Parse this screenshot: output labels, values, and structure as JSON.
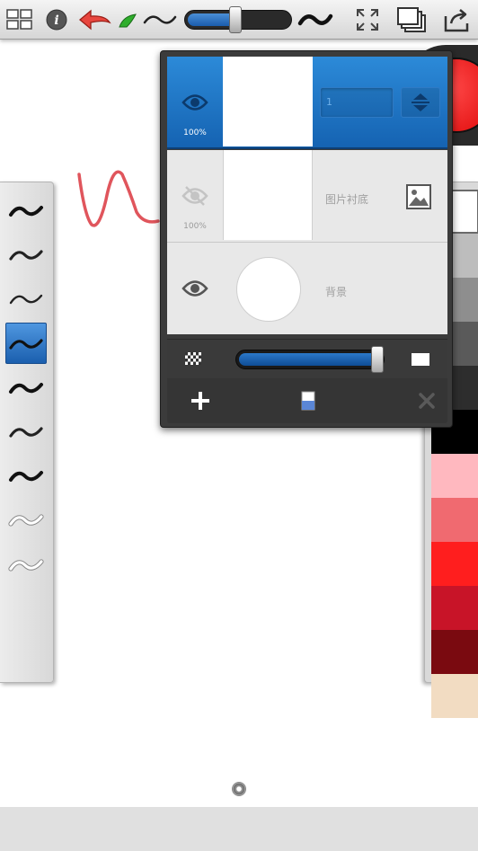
{
  "colors": {
    "accent": "#1a6ec2",
    "current_color": "#e81010"
  },
  "toolbar": {
    "items": [
      {
        "name": "grid-menu-icon"
      },
      {
        "name": "info-icon"
      },
      {
        "name": "undo-icon"
      },
      {
        "name": "brush-tool-icon"
      },
      {
        "name": "brush-size-small-icon"
      },
      {
        "name": "brush-size-large-icon"
      },
      {
        "name": "fullscreen-icon"
      },
      {
        "name": "layers-icon"
      },
      {
        "name": "share-icon"
      }
    ],
    "brush_size_level": 0.5
  },
  "brushes": {
    "items": [
      "tilde-bold",
      "tilde-medium",
      "tilde-thin",
      "tilde-selected",
      "tilde-bold",
      "tilde-medium",
      "tilde-bold",
      "tilde-white-outline",
      "tilde-white-outline"
    ],
    "selected_index": 3
  },
  "palette": {
    "swatches": [
      "#ffffff",
      "#bdbdbd",
      "#8e8e8e",
      "#5a5a5a",
      "#2d2d2d",
      "#000000",
      "#ffb8bf",
      "#f06a70",
      "#ff1e1e",
      "#c81428",
      "#7a0a10",
      "#f2dcc2"
    ],
    "selected_index": 0
  },
  "layers": {
    "rows": [
      {
        "opacity": "100%",
        "name_value": "1",
        "visible": true
      },
      {
        "opacity": "100%",
        "label": "图片衬底",
        "visible": false
      },
      {
        "label": "背景",
        "visible": true
      }
    ],
    "opacity_level": 1.0
  }
}
